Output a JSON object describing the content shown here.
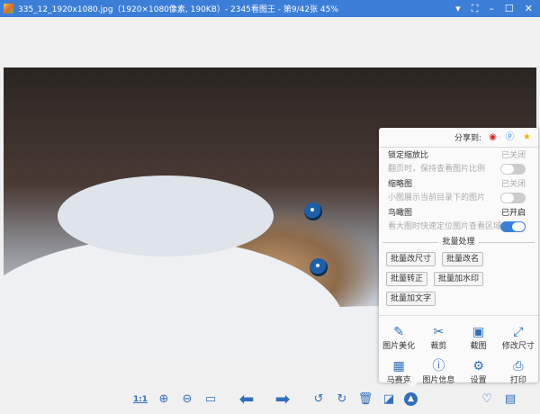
{
  "window": {
    "title": "335_12_1920x1080.jpg（1920×1080像素, 190KB）- 2345看图王 - 第9/42张 45%"
  },
  "panel": {
    "share_label": "分享到:",
    "options": [
      {
        "name": "锁定缩放比",
        "desc": "翻页时，保持查看图片比例",
        "state": "已关闭",
        "enabled": false
      },
      {
        "name": "缩略图",
        "desc": "小图展示当前目录下的图片",
        "state": "已关闭",
        "enabled": false
      },
      {
        "name": "鸟瞰图",
        "desc": "看大图时快速定位图片查看区域",
        "state": "已开启",
        "enabled": true
      }
    ],
    "batch_title": "批量处理",
    "batch_buttons": [
      "批量改尺寸",
      "批量改名",
      "批量转正",
      "批量加水印",
      "批量加文字"
    ],
    "tools": [
      {
        "label": "图片美化",
        "icon": "edit-icon"
      },
      {
        "label": "裁剪",
        "icon": "scissors-icon"
      },
      {
        "label": "截图",
        "icon": "screenshot-icon"
      },
      {
        "label": "修改尺寸",
        "icon": "resize-icon"
      },
      {
        "label": "马赛克",
        "icon": "mosaic-icon"
      },
      {
        "label": "图片信息",
        "icon": "info-icon"
      },
      {
        "label": "设置",
        "icon": "gear-icon"
      },
      {
        "label": "打印",
        "icon": "printer-icon"
      }
    ]
  },
  "toolbar": {
    "actual_size": "1:1"
  }
}
